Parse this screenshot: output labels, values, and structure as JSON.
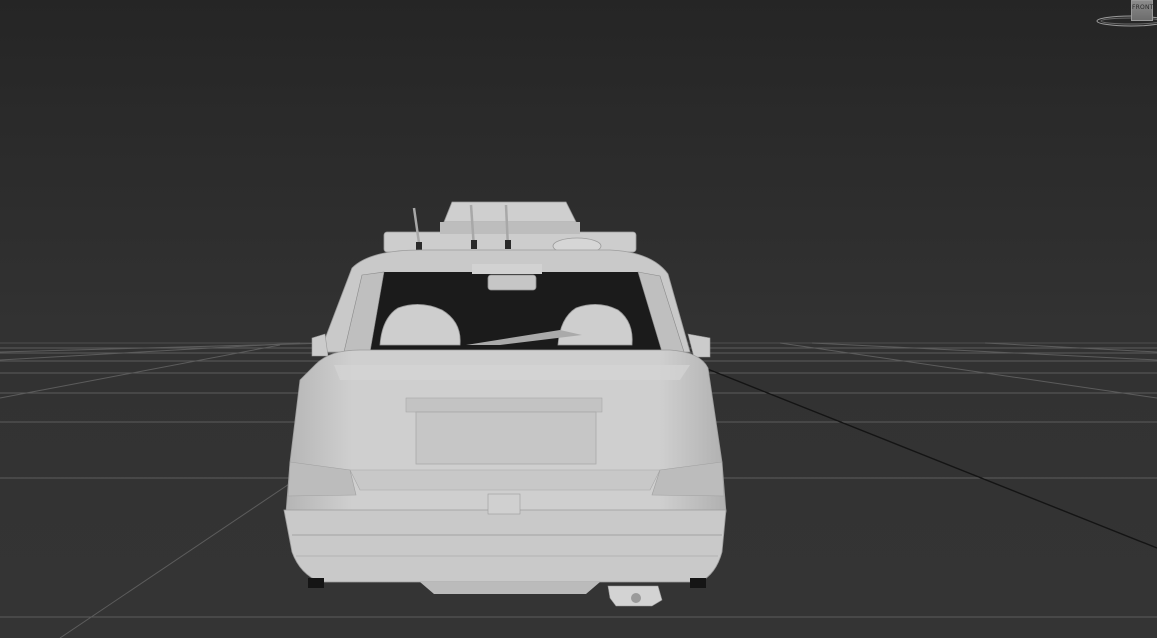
{
  "viewport": {
    "background_top": "#252525",
    "background_bottom": "#343434",
    "grid_color": "#5a5a5a",
    "grid_axis_color": "#151515",
    "model_color": "#c8c8c8"
  },
  "viewcube": {
    "face_label": "FRONT",
    "icon": "viewcube-icon"
  }
}
